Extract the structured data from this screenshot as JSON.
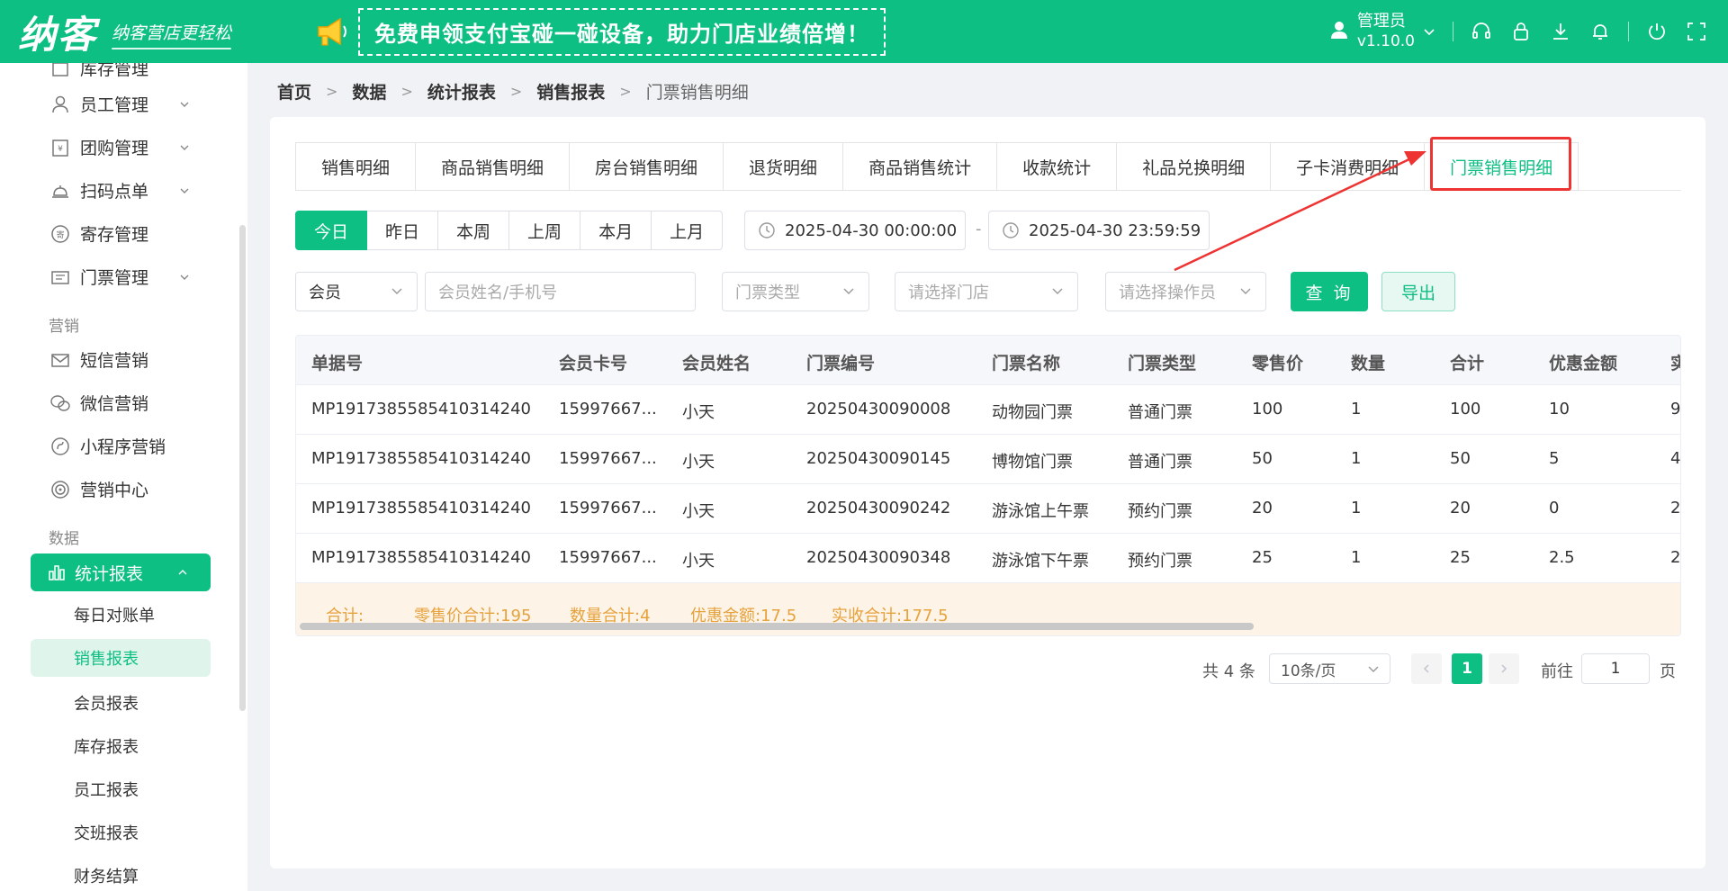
{
  "header": {
    "logo": "纳客",
    "slogan": "纳客营店更轻松",
    "promo_text": "免费申领支付宝碰一碰设备，助力门店业绩倍增！",
    "user_name": "管理员",
    "version": "v1.10.0"
  },
  "sidebar": {
    "top_items": [
      {
        "label": "库存管理",
        "icon": "box-icon"
      },
      {
        "label": "员工管理",
        "icon": "user-icon"
      },
      {
        "label": "团购管理",
        "icon": "coupon-icon"
      },
      {
        "label": "扫码点单",
        "icon": "bell-icon"
      },
      {
        "label": "寄存管理",
        "icon": "deposit-icon"
      },
      {
        "label": "门票管理",
        "icon": "ticket-icon"
      }
    ],
    "group_marketing": "营销",
    "marketing_items": [
      {
        "label": "短信营销",
        "icon": "mail-icon"
      },
      {
        "label": "微信营销",
        "icon": "wechat-icon"
      },
      {
        "label": "小程序营销",
        "icon": "miniapp-icon"
      },
      {
        "label": "营销中心",
        "icon": "target-icon"
      }
    ],
    "group_data": "数据",
    "active_item": "统计报表",
    "sub_items": [
      "每日对账单",
      "销售报表",
      "会员报表",
      "库存报表",
      "员工报表",
      "交班报表",
      "财务结算"
    ]
  },
  "breadcrumb": [
    "首页",
    "数据",
    "统计报表",
    "销售报表",
    "门票销售明细"
  ],
  "tabs": [
    "销售明细",
    "商品销售明细",
    "房台销售明细",
    "退货明细",
    "商品销售统计",
    "收款统计",
    "礼品兑换明细",
    "子卡消费明细",
    "门票销售明细"
  ],
  "active_tab": "门票销售明细",
  "date_buttons": [
    "今日",
    "昨日",
    "本周",
    "上周",
    "本月",
    "上月"
  ],
  "date_start": "2025-04-30 00:00:00",
  "date_sep": "-",
  "date_end": "2025-04-30 23:59:59",
  "filters": {
    "member_select": "会员",
    "member_placeholder": "会员姓名/手机号",
    "ticket_type_placeholder": "门票类型",
    "store_placeholder": "请选择门店",
    "operator_placeholder": "请选择操作员",
    "query_label": "查 询",
    "export_label": "导出"
  },
  "table": {
    "columns": [
      "单据号",
      "会员卡号",
      "会员姓名",
      "门票编号",
      "门票名称",
      "门票类型",
      "零售价",
      "数量",
      "合计",
      "优惠金额",
      "实"
    ],
    "rows": [
      [
        "MP1917385585410314240",
        "15997667...",
        "小天",
        "20250430090008",
        "动物园门票",
        "普通门票",
        "100",
        "1",
        "100",
        "10",
        "9"
      ],
      [
        "MP1917385585410314240",
        "15997667...",
        "小天",
        "20250430090145",
        "博物馆门票",
        "普通门票",
        "50",
        "1",
        "50",
        "5",
        "4"
      ],
      [
        "MP1917385585410314240",
        "15997667...",
        "小天",
        "20250430090242",
        "游泳馆上午票",
        "预约门票",
        "20",
        "1",
        "20",
        "0",
        "2"
      ],
      [
        "MP1917385585410314240",
        "15997667...",
        "小天",
        "20250430090348",
        "游泳馆下午票",
        "预约门票",
        "25",
        "1",
        "25",
        "2.5",
        "2"
      ]
    ],
    "footer": [
      "合计:",
      "零售价合计:195",
      "数量合计:4",
      "优惠金额:17.5",
      "实收合计:177.5"
    ]
  },
  "pagination": {
    "total": "共 4 条",
    "page_size": "10条/页",
    "current_page": "1",
    "goto_label": "前往",
    "goto_value": "1",
    "page_unit": "页"
  },
  "colors": {
    "accent": "#0dbf82",
    "highlight": "#e33333",
    "footer_text": "#e6a23c"
  }
}
